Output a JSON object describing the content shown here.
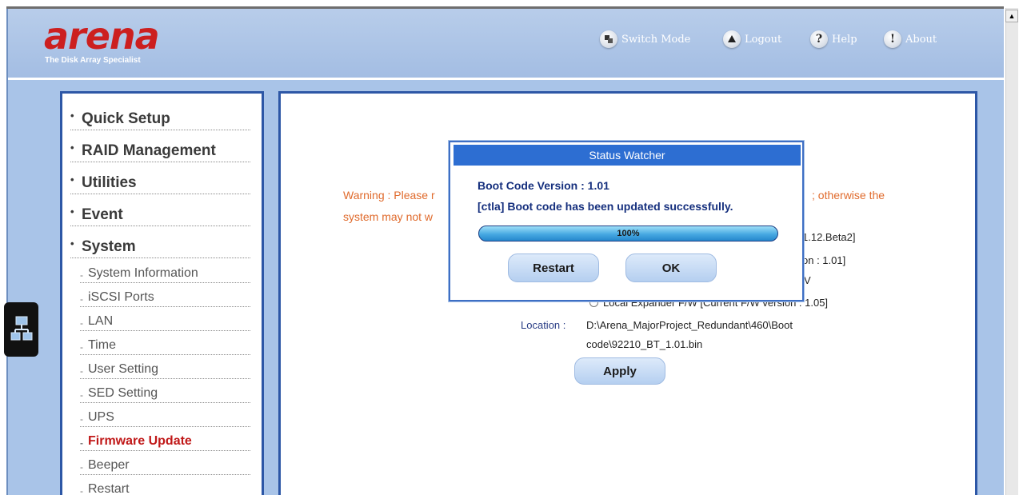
{
  "brand": {
    "logo": "arena",
    "tagline": "The Disk Array Specialist"
  },
  "header": {
    "switch_mode": "Switch Mode",
    "logout": "Logout",
    "help": "Help",
    "about": "About"
  },
  "sidebar": {
    "sections": [
      {
        "label": "Quick Setup"
      },
      {
        "label": "RAID Management"
      },
      {
        "label": "Utilities"
      },
      {
        "label": "Event"
      },
      {
        "label": "System"
      }
    ],
    "sub_items": [
      {
        "label": "System Information"
      },
      {
        "label": "iSCSI Ports"
      },
      {
        "label": "LAN"
      },
      {
        "label": "Time"
      },
      {
        "label": "User Setting"
      },
      {
        "label": "SED Setting"
      },
      {
        "label": "UPS"
      },
      {
        "label": "Firmware Update",
        "active": true
      },
      {
        "label": "Beeper"
      },
      {
        "label": "Restart"
      }
    ]
  },
  "content": {
    "warning_left": "Warning : Please r",
    "warning_right": "; otherwise the",
    "warning_line2": "system may not w",
    "partial_1": "1.12.Beta2]",
    "partial_2": "on : 1.01]",
    "partial_3": "V",
    "expander_line": "Local Expander F/W [Current F/W version : 1.05]",
    "location_label": "Location :",
    "location_line1": "D:\\Arena_MajorProject_Redundant\\460\\Boot",
    "location_line2": "code\\92210_BT_1.01.bin",
    "apply_label": "Apply"
  },
  "dialog": {
    "title": "Status Watcher",
    "line1": "Boot Code Version : 1.01",
    "line2": "[ctla] Boot code has been updated successfully.",
    "progress_text": "100%",
    "progress_value": 1.0,
    "restart_label": "Restart",
    "ok_label": "OK"
  }
}
